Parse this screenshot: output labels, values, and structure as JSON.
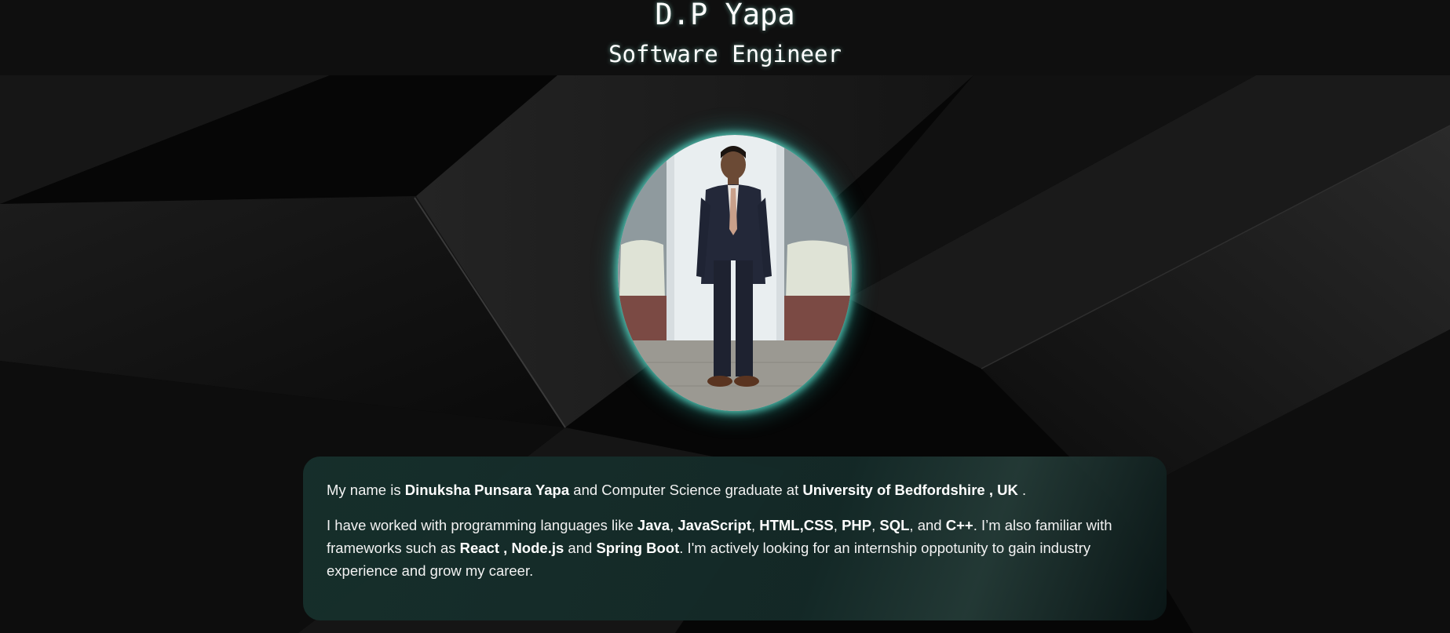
{
  "header": {
    "name": "D.P Yapa",
    "role": "Software Engineer"
  },
  "profile_photo": {
    "icon": "profile-photo",
    "glow_color": "#5adcc8"
  },
  "about": {
    "p1": {
      "t1": "My name is ",
      "name": "Dinuksha Punsara Yapa",
      "t2": " and Computer Science graduate at ",
      "university": "University of Bedfordshire , UK",
      "t3": " ."
    },
    "p2": {
      "t1": "I have worked with programming languages like ",
      "java": "Java",
      "s1": ", ",
      "javascript": "JavaScript",
      "s2": ", ",
      "htmlcss": "HTML,CSS",
      "s3": ", ",
      "php": "PHP",
      "s4": ", ",
      "sql": "SQL",
      "s5": ", and ",
      "cpp": "C++",
      "t2": ". I’m also familiar with frameworks such as ",
      "react_node": "React , Node.js",
      "t3": " and ",
      "spring": "Spring Boot",
      "t4": ". I'm actively looking for an internship oppotunity to gain industry experience and grow my career."
    }
  },
  "colors": {
    "background": "#070707",
    "header_bg": "#0f0f0f",
    "card_bg": "#16302c",
    "accent_glow": "#5adcc8"
  }
}
